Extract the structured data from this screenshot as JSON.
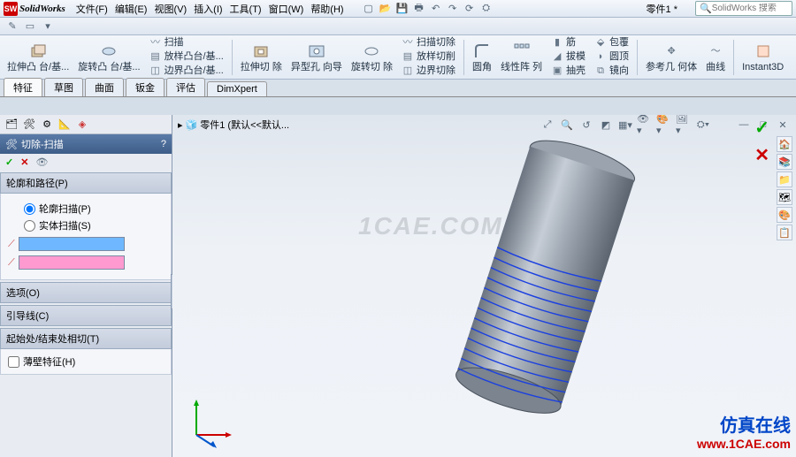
{
  "app": {
    "logo_letters": "SW",
    "name": "SolidWorks"
  },
  "menu": [
    "文件(F)",
    "编辑(E)",
    "视图(V)",
    "插入(I)",
    "工具(T)",
    "窗口(W)",
    "帮助(H)"
  ],
  "doc_title": "零件1 *",
  "search_placeholder": "SolidWorks 搜索",
  "ribbon": {
    "big": [
      {
        "icon": "extrude",
        "label": "拉伸凸\n台/基..."
      },
      {
        "icon": "revolve",
        "label": "旋转凸\n台/基..."
      }
    ],
    "col1": [
      {
        "icon": "sweep",
        "label": "扫描"
      },
      {
        "icon": "loft",
        "label": "放样凸台/基..."
      },
      {
        "icon": "boundary",
        "label": "边界凸台/基..."
      }
    ],
    "big2": [
      {
        "icon": "extcut",
        "label": "拉伸切\n除"
      },
      {
        "icon": "hole",
        "label": "异型孔\n向导"
      },
      {
        "icon": "revcut",
        "label": "旋转切\n除"
      }
    ],
    "col2": [
      {
        "icon": "swcut",
        "label": "扫描切除"
      },
      {
        "icon": "loftcut",
        "label": "放样切削"
      },
      {
        "icon": "bndcut",
        "label": "边界切除"
      }
    ],
    "big3": [
      {
        "icon": "fillet",
        "label": "圆角"
      },
      {
        "icon": "pattern",
        "label": "线性阵\n列"
      }
    ],
    "col3": [
      {
        "icon": "rib",
        "label": "筋"
      },
      {
        "icon": "draft",
        "label": "拔模"
      },
      {
        "icon": "shell",
        "label": "抽壳"
      }
    ],
    "col4": [
      {
        "icon": "wrap",
        "label": "包覆"
      },
      {
        "icon": "dome",
        "label": "圆顶"
      },
      {
        "icon": "mirror",
        "label": "镜向"
      }
    ],
    "big4": [
      {
        "icon": "refgeo",
        "label": "参考几\n何体"
      },
      {
        "icon": "curves",
        "label": "曲线"
      }
    ],
    "instant": "Instant3D"
  },
  "tabs": [
    "特征",
    "草图",
    "曲面",
    "钣金",
    "评估",
    "DimXpert"
  ],
  "feature_tree_root": "零件1 (默认<<默认...",
  "pm": {
    "title": "切除-扫描",
    "sec_profile": "轮廓和路径(P)",
    "opt_sketch": "轮廓扫描(P)",
    "opt_solid": "实体扫描(S)",
    "sec_options": "选项(O)",
    "sec_guides": "引导线(C)",
    "sec_startend": "起始处/结束处相切(T)",
    "chk_thin": "薄壁特征(H)"
  },
  "view_icons": [
    "zoom-fit-icon",
    "zoom-area-icon",
    "rotate-icon",
    "section-icon",
    "display-style-icon",
    "hide-show-icon",
    "appearance-icon",
    "scene-icon",
    "view-settings-icon"
  ],
  "ok_check": "✓",
  "cancel_x": "✕",
  "watermark": "1CAE.COM",
  "brand_cn": "仿真在线",
  "brand_url": "www.1CAE.com",
  "colors": {
    "accent": "#3e5d88",
    "profile_swatch": "#6fb8ff",
    "path_swatch": "#ff9ad0"
  }
}
